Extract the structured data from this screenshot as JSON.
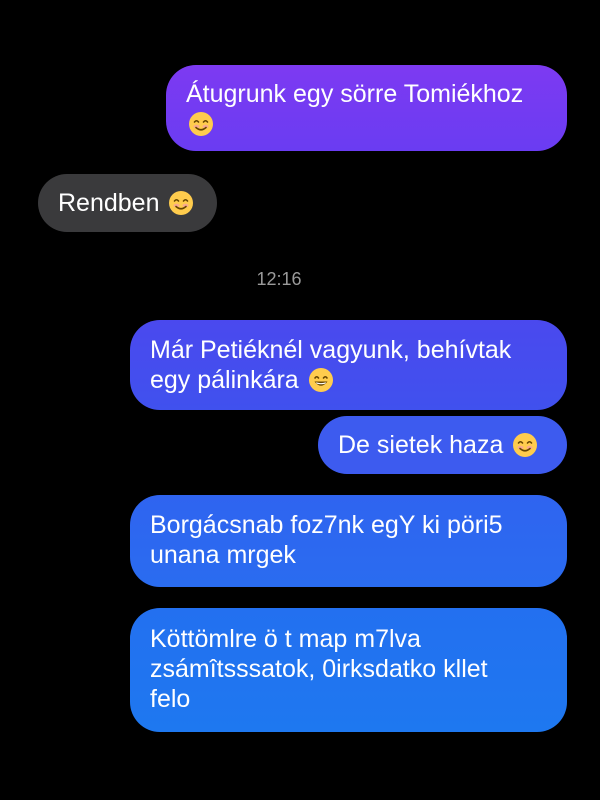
{
  "thread": {
    "colors": {
      "background": "#000000",
      "incoming_bubble": "#3a3a3c",
      "outgoing_gradient_top": "#8e2ff0",
      "outgoing_gradient_bottom": "#1e74f0",
      "timestamp_text": "#9a9a9a"
    },
    "timestamp": "12:16",
    "messages": [
      {
        "direction": "outgoing",
        "lines": [
          "Átugrunk egy sörre Tomiékhoz",
          ""
        ],
        "emoji": "smiling-face-emoji"
      },
      {
        "direction": "incoming",
        "lines": [
          "Rendben"
        ],
        "emoji": "smiling-face-emoji"
      },
      {
        "direction": "outgoing",
        "lines": [
          "Már Petiéknél vagyunk, behívtak",
          "egy pálinkára"
        ],
        "emoji": "grinning-face-emoji"
      },
      {
        "direction": "outgoing",
        "lines": [
          "De sietek haza"
        ],
        "emoji": "smiling-face-emoji"
      },
      {
        "direction": "outgoing",
        "lines": [
          "Borgácsnab foz7nk egY ki pöri5",
          "unana mrgek"
        ]
      },
      {
        "direction": "outgoing",
        "lines": [
          "Köttömlre ö t map m7lva",
          "zsámîtsssatok, 0irksdatko kllet",
          "felo"
        ]
      }
    ]
  }
}
